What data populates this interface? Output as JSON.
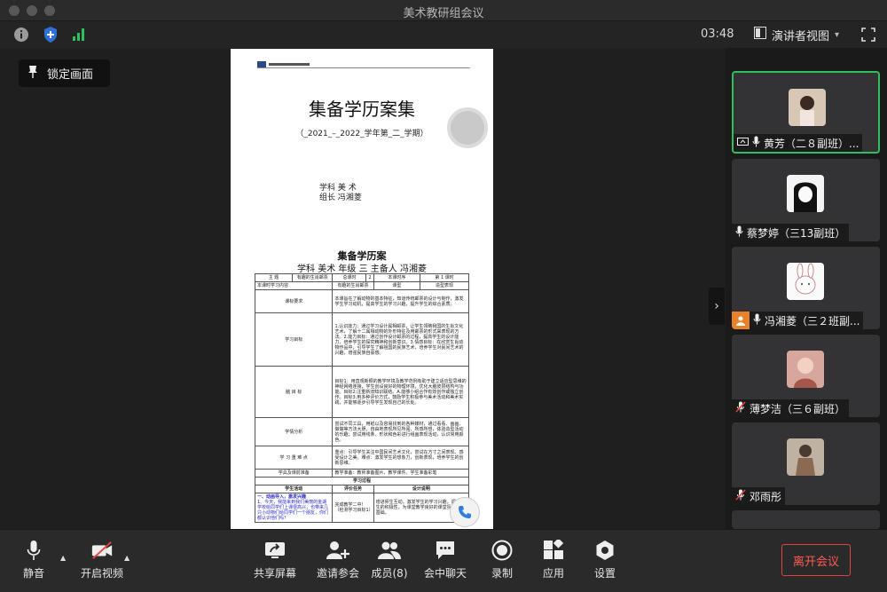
{
  "window": {
    "title": "美术教研组会议"
  },
  "status": {
    "time": "03:48",
    "view_label": "演讲者视图",
    "view_caret": "▾"
  },
  "stage": {
    "lock_label": "锁定画面",
    "document": {
      "title": "集备学历案集",
      "term": "（_2021_–_2022_学年第_二_学期）",
      "subject": "学科  美 术",
      "leader": "组长  冯湘菱",
      "title2": "集备学历案",
      "line2": "学科  美术 年级  三  主备人  冯湘菱",
      "table": {
        "row1": [
          "主 题",
          "有趣的生肖邮票",
          "总课时",
          "2",
          "本课时序",
          "第 1 课时"
        ],
        "row2": [
          "本课时学习内容",
          "有趣的生肖邮票",
          "课型",
          "造型表现"
        ],
        "rows": [
          {
            "label": "课标要求",
            "text": "本课旨在了解动物的基本特征，知道传统邮票的设计与制作，激发学生学习动机，提高学生的学习兴趣，提升学生的综合素质。"
          },
          {
            "label": "学习目标",
            "text": "1.认识能力：通过学习设计属相邮票，让学生领略我国的生肖文化艺术，了解十二属相动物的外形特征及用邮票的形式来表现的方法。2.能力目标：通过创作设计邮票的过程，提高学生的设计能力，培养学生的探究精神和创新意识。3.情感目标：在欣赏生肖动物作品中，引导学生了解祖国的民族艺术，培养学生对民间艺术的兴趣，增强民族自豪感。"
          },
          {
            "label": "脑 目 标",
            "text": "目标1：用直观新颖的教学环境及教学范例有助于建立适应型思维的神经网络连接，学生创设良好的物理环境，优化大脑皮层结构与功能。目标2:注重新旧知识联结。A.能够小组合作有效创作或独立创作。目标3:用多种评价方式，鼓励学生积极参与美术活动和美术实践，并能够逐步引导学生发现自己的长处。"
          },
          {
            "label": "学情分析",
            "text": "尝试不同工具，用纸以及容易找到的各种媒材，通过看看、画画、做做等方法大胆、自由地表现所见所闻、所感所想，体验造型活动的乐趣；尝试用线条、形状和色彩进行组画表现活动，认识常用颜色。"
          },
          {
            "label": "学 习 重 难 点",
            "text": "重点：引导学生关注中国民间艺术文化，尝试在方寸之间表现、感受设计之美。难点：激发学生的想象力，创新表现，培养学生的创新思维。"
          },
          {
            "label": "学具及课前准备",
            "text": "教学准备：教师准备图片、教学课件。学生准备彩笔"
          }
        ],
        "process_header": "学习过程",
        "col_heads": [
          "学生活动",
          "评价任务",
          "设计说明"
        ],
        "step_title": "一、动画导入，激发兴趣",
        "step_text": "1、今天，我能来到我们美丽的金湖学校给同学们上课很高兴，也带来几只小动物们给同学们一个朋友，你们都认识他们吗？",
        "step_eval": "完成教学二中!（检测学习目标1）",
        "step_note": "增进师生互动，激发学生的学习兴趣，调动学生的积极性，为课堂教学良好的课堂氛围打好基础。"
      }
    }
  },
  "participants": [
    {
      "name": "黄芳（二８副班）...",
      "mic": "on",
      "sharing": true,
      "active": true,
      "avatar_color": "#d9c7b6"
    },
    {
      "name": "蔡梦婷（三13副班）",
      "mic": "on",
      "sharing": false,
      "active": false,
      "avatar_color": "#f4f4f4"
    },
    {
      "name": "冯湘菱（三２班副...",
      "mic": "on",
      "sharing": false,
      "host": true,
      "active": false,
      "avatar_color": "#fafafa"
    },
    {
      "name": "薄梦洁（三６副班）",
      "mic": "muted",
      "sharing": false,
      "active": false,
      "avatar_color": "#d7a79c"
    },
    {
      "name": "邓雨彤",
      "mic": "muted",
      "sharing": false,
      "active": false,
      "avatar_color": "#bfb2a2"
    }
  ],
  "toolbar": {
    "mute_label": "静音",
    "video_label": "开启视频",
    "share_label": "共享屏幕",
    "invite_label": "邀请参会",
    "members_label": "成员(8)",
    "chat_label": "会中聊天",
    "record_label": "录制",
    "apps_label": "应用",
    "settings_label": "设置",
    "leave_label": "离开会议"
  },
  "colors": {
    "active_border": "#2fbf5e",
    "leave_red": "#e0443c",
    "host_orange": "#e8822a",
    "shield_blue": "#2f6fd8",
    "signal_green": "#2fbf5e"
  }
}
